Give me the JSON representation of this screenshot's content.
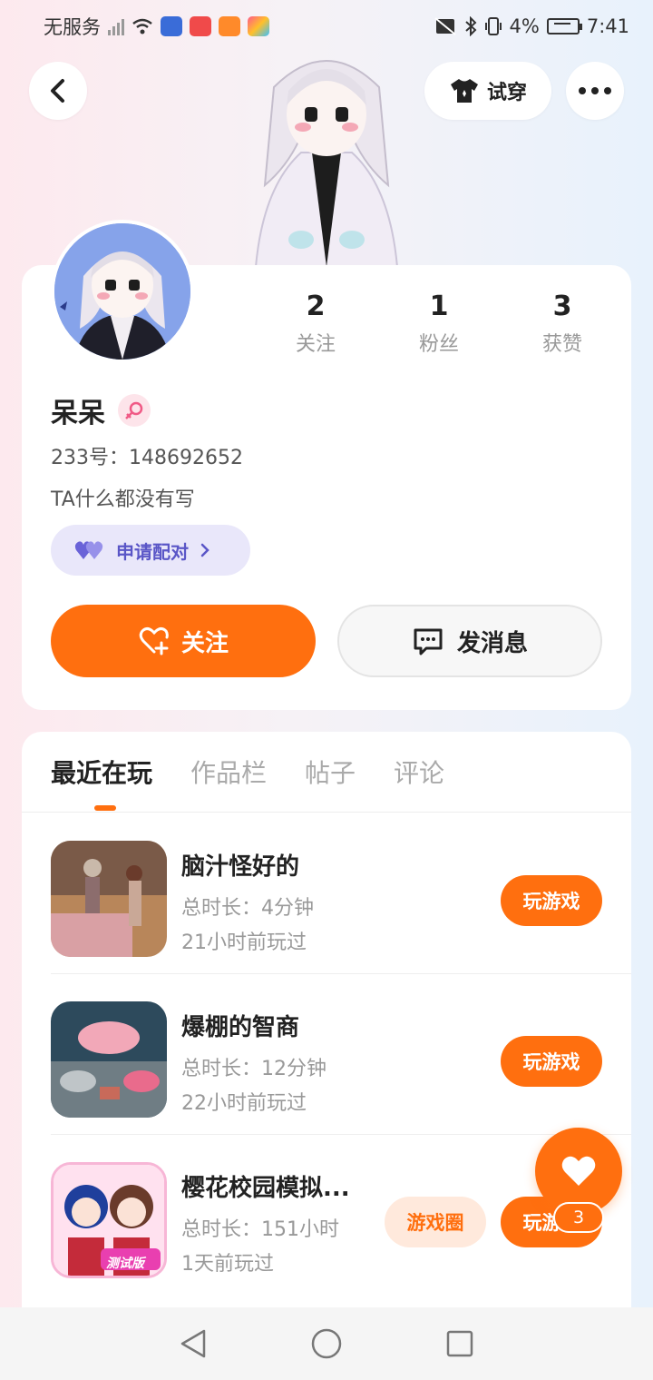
{
  "status_bar": {
    "carrier": "无服务",
    "battery": "4%",
    "time": "7:41"
  },
  "header": {
    "try_on_label": "试穿"
  },
  "profile": {
    "name": "呆呆",
    "gender_icon": "female-icon",
    "uid": "233号：148692652",
    "bio": "TA什么都没有写",
    "pair_label": "申请配对",
    "stats": [
      {
        "value": "2",
        "label": "关注"
      },
      {
        "value": "1",
        "label": "粉丝"
      },
      {
        "value": "3",
        "label": "获赞"
      }
    ],
    "follow_label": "关注",
    "message_label": "发消息"
  },
  "tabs": [
    {
      "label": "最近在玩",
      "active": true
    },
    {
      "label": "作品栏",
      "active": false
    },
    {
      "label": "帖子",
      "active": false
    },
    {
      "label": "评论",
      "active": false
    }
  ],
  "games": [
    {
      "title": "脑汁怪好的",
      "duration": "总时长：4分钟",
      "last_played": "21小时前玩过",
      "play_label": "玩游戏"
    },
    {
      "title": "爆棚的智商",
      "duration": "总时长：12分钟",
      "last_played": "22小时前玩过",
      "play_label": "玩游戏"
    },
    {
      "title": "樱花校园模拟...",
      "duration": "总时长：151小时",
      "last_played": "1天前玩过",
      "circle_label": "游戏圈",
      "play_label": "玩游戏",
      "icon_badge": "测试版"
    }
  ],
  "like_fab": {
    "count": "3"
  },
  "colors": {
    "accent": "#ff6f0f",
    "pair_bg": "#e9e7fa",
    "pair_text": "#5a56c7"
  }
}
